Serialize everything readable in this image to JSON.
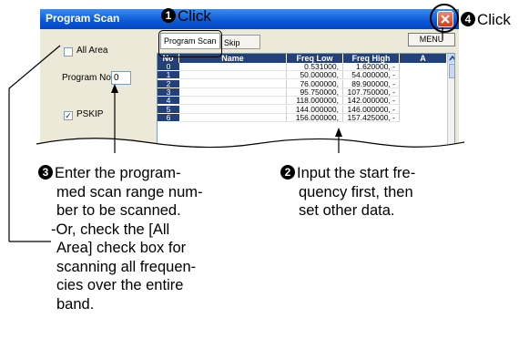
{
  "window": {
    "title": "Program Scan",
    "tabs": [
      "Program Scan",
      "Skip Area"
    ],
    "menu_label": "MENU",
    "close_icon": "close-icon",
    "all_area_label": "All Area",
    "all_area_checked": false,
    "program_no_label": "Program No",
    "program_no_value": "0",
    "pskip_label": "PSKIP",
    "pskip_checked": true
  },
  "grid": {
    "headers": [
      "No",
      "Name",
      "Freq Low",
      "Freq High",
      "A"
    ],
    "rows": [
      {
        "no": "0",
        "name": "",
        "low": "0.531000,",
        "high": "1.620000, -"
      },
      {
        "no": "1",
        "name": "",
        "low": "50.000000,",
        "high": "54.000000, -"
      },
      {
        "no": "2",
        "name": "",
        "low": "76.000000,",
        "high": "89.900000, -"
      },
      {
        "no": "3",
        "name": "",
        "low": "95.750000,",
        "high": "107.750000, -"
      },
      {
        "no": "4",
        "name": "",
        "low": "118.000000,",
        "high": "142.000000, -"
      },
      {
        "no": "5",
        "name": "",
        "low": "144.000000,",
        "high": "146.000000, -"
      },
      {
        "no": "6",
        "name": "",
        "low": "156.000000,",
        "high": "157.425000, -"
      }
    ]
  },
  "callouts": {
    "step1": {
      "num": "1",
      "text": "Click"
    },
    "step4": {
      "num": "4",
      "text": "Click"
    },
    "step2": {
      "num": "2",
      "lines": [
        "Input the start fre-",
        "quency first, then",
        "set other data."
      ]
    },
    "step3": {
      "num": "3",
      "lines": [
        "Enter the program-",
        "med scan range num-",
        "ber to be scanned.",
        "-Or, check the [All",
        "Area] check box for",
        "scanning all frequen-",
        "cies over the entire",
        "band."
      ]
    }
  },
  "colors": {
    "titlebar": "#0a57d6",
    "header": "#24407a",
    "close": "#d43a18"
  }
}
